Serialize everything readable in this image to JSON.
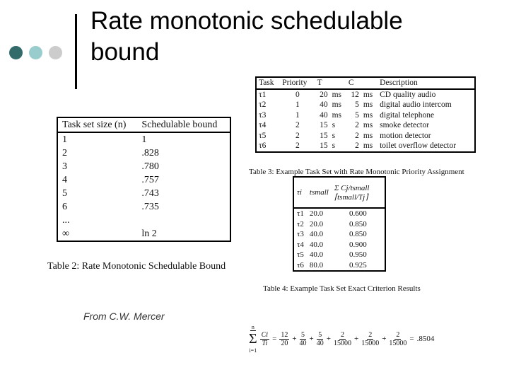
{
  "slide": {
    "title_line1": "Rate monotonic schedulable",
    "title_line2": "bound",
    "credit": "From C.W. Mercer",
    "colors": {
      "dot1": "#336b6b",
      "dot2": "#99cccc",
      "dot3": "#cccccc"
    }
  },
  "table2": {
    "headers": [
      "Task set size (n)",
      "Schedulable bound"
    ],
    "rows": [
      [
        "1",
        "1"
      ],
      [
        "2",
        ".828"
      ],
      [
        "3",
        ".780"
      ],
      [
        "4",
        ".757"
      ],
      [
        "5",
        ".743"
      ],
      [
        "6",
        ".735"
      ],
      [
        "...",
        ""
      ],
      [
        "∞",
        "ln 2"
      ]
    ],
    "caption": "Table 2: Rate Monotonic Schedulable Bound"
  },
  "table3": {
    "headers": [
      "Task",
      "Priority",
      "T",
      "",
      "C",
      "",
      "Description"
    ],
    "rows": [
      [
        "τ1",
        "0",
        "20",
        "ms",
        "12",
        "ms",
        "CD quality audio"
      ],
      [
        "τ2",
        "1",
        "40",
        "ms",
        "5",
        "ms",
        "digital audio intercom"
      ],
      [
        "τ3",
        "1",
        "40",
        "ms",
        "5",
        "ms",
        "digital telephone"
      ],
      [
        "τ4",
        "2",
        "15",
        "s",
        "2",
        "ms",
        "smoke detector"
      ],
      [
        "τ5",
        "2",
        "15",
        "s",
        "2",
        "ms",
        "motion detector"
      ],
      [
        "τ6",
        "2",
        "15",
        "s",
        "2",
        "ms",
        "toilet overflow detector"
      ]
    ],
    "caption": "Table 3: Example Task Set with Rate Monotonic Priority Assignment"
  },
  "table4": {
    "headers": [
      "τi",
      "tsmall",
      "Σ Cj/tsmall ⌈tsmall/Tj⌉"
    ],
    "rows": [
      [
        "τ1",
        "20.0",
        "0.600"
      ],
      [
        "τ2",
        "20.0",
        "0.850"
      ],
      [
        "τ3",
        "40.0",
        "0.850"
      ],
      [
        "τ4",
        "40.0",
        "0.900"
      ],
      [
        "τ5",
        "40.0",
        "0.950"
      ],
      [
        "τ6",
        "80.0",
        "0.925"
      ]
    ],
    "caption": "Table 4: Example Task Set Exact Criterion Results"
  },
  "formula": {
    "lhs_num": "Ci",
    "lhs_den": "Ti",
    "sum": "Σ",
    "sum_top": "n",
    "sum_bottom": "i=1",
    "terms": [
      [
        "12",
        "20"
      ],
      [
        "5",
        "40"
      ],
      [
        "5",
        "40"
      ],
      [
        "2",
        "15000"
      ],
      [
        "2",
        "15000"
      ],
      [
        "2",
        "15000"
      ]
    ],
    "result": ".8504"
  }
}
